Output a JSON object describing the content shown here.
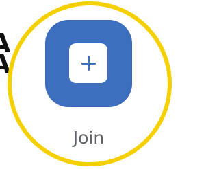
{
  "edge_text": "A\nA\n:",
  "join": {
    "label": "Join",
    "icon": "plus-square-icon"
  },
  "colors": {
    "highlight_ring": "#f5d000",
    "tile": "#3d6fbe",
    "label": "#5f6368"
  }
}
